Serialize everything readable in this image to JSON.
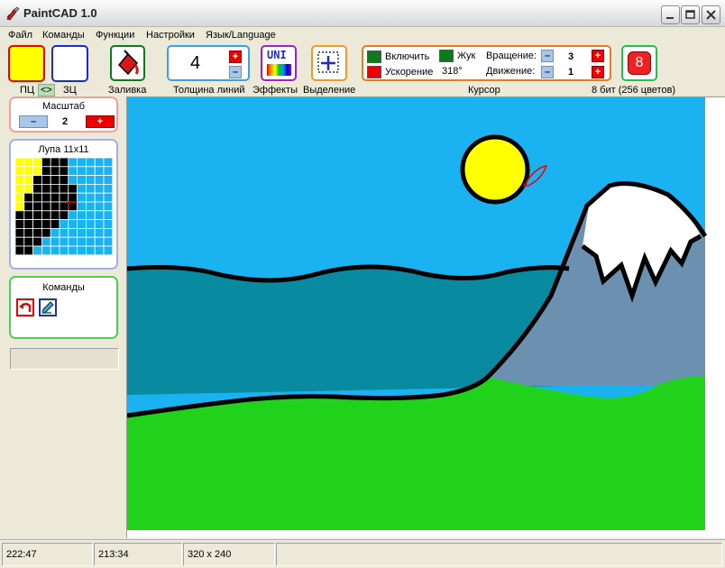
{
  "window": {
    "title": "PaintCAD 1.0"
  },
  "menu": [
    "Файл",
    "Команды",
    "Функции",
    "Настройки",
    "Язык/Language"
  ],
  "toolbar": {
    "primary_label": "ПЦ",
    "swap_label": "<>",
    "secondary_label": "ЗЦ",
    "fill_label": "Заливка",
    "line_width_value": "4",
    "line_width_label": "Толщина линий",
    "effects_badge": "UNI",
    "effects_label": "Эффекты",
    "selection_label": "Выделение",
    "cursor": {
      "enable_label": "Включить",
      "bug_label": "Жук",
      "rotation_label": "Вращение:",
      "rotation_value": "3",
      "accel_label": "Ускорение",
      "angle_value": "318°",
      "move_label": "Движение:",
      "move_value": "1",
      "group_label": "Курсор"
    },
    "bits_value": "8",
    "bits_label": "8 бит (256 цветов)",
    "plus": "+",
    "minus": "–"
  },
  "left": {
    "scale_title": "Масштаб",
    "scale_value": "2",
    "loupe_title": "Лупа 11х11",
    "commands_title": "Команды"
  },
  "status": {
    "cursor_pos": "222:47",
    "image_pos": "213:34",
    "image_size": "320 x 240"
  },
  "colors": {
    "primary": "#ffff00",
    "secondary": "#ffffff",
    "sky": "#1ab2f0",
    "sea": "#088ba0",
    "grass": "#21d21c",
    "mountain": "#6c91b0",
    "snow": "#ffffff",
    "sun": "#ffff00"
  }
}
